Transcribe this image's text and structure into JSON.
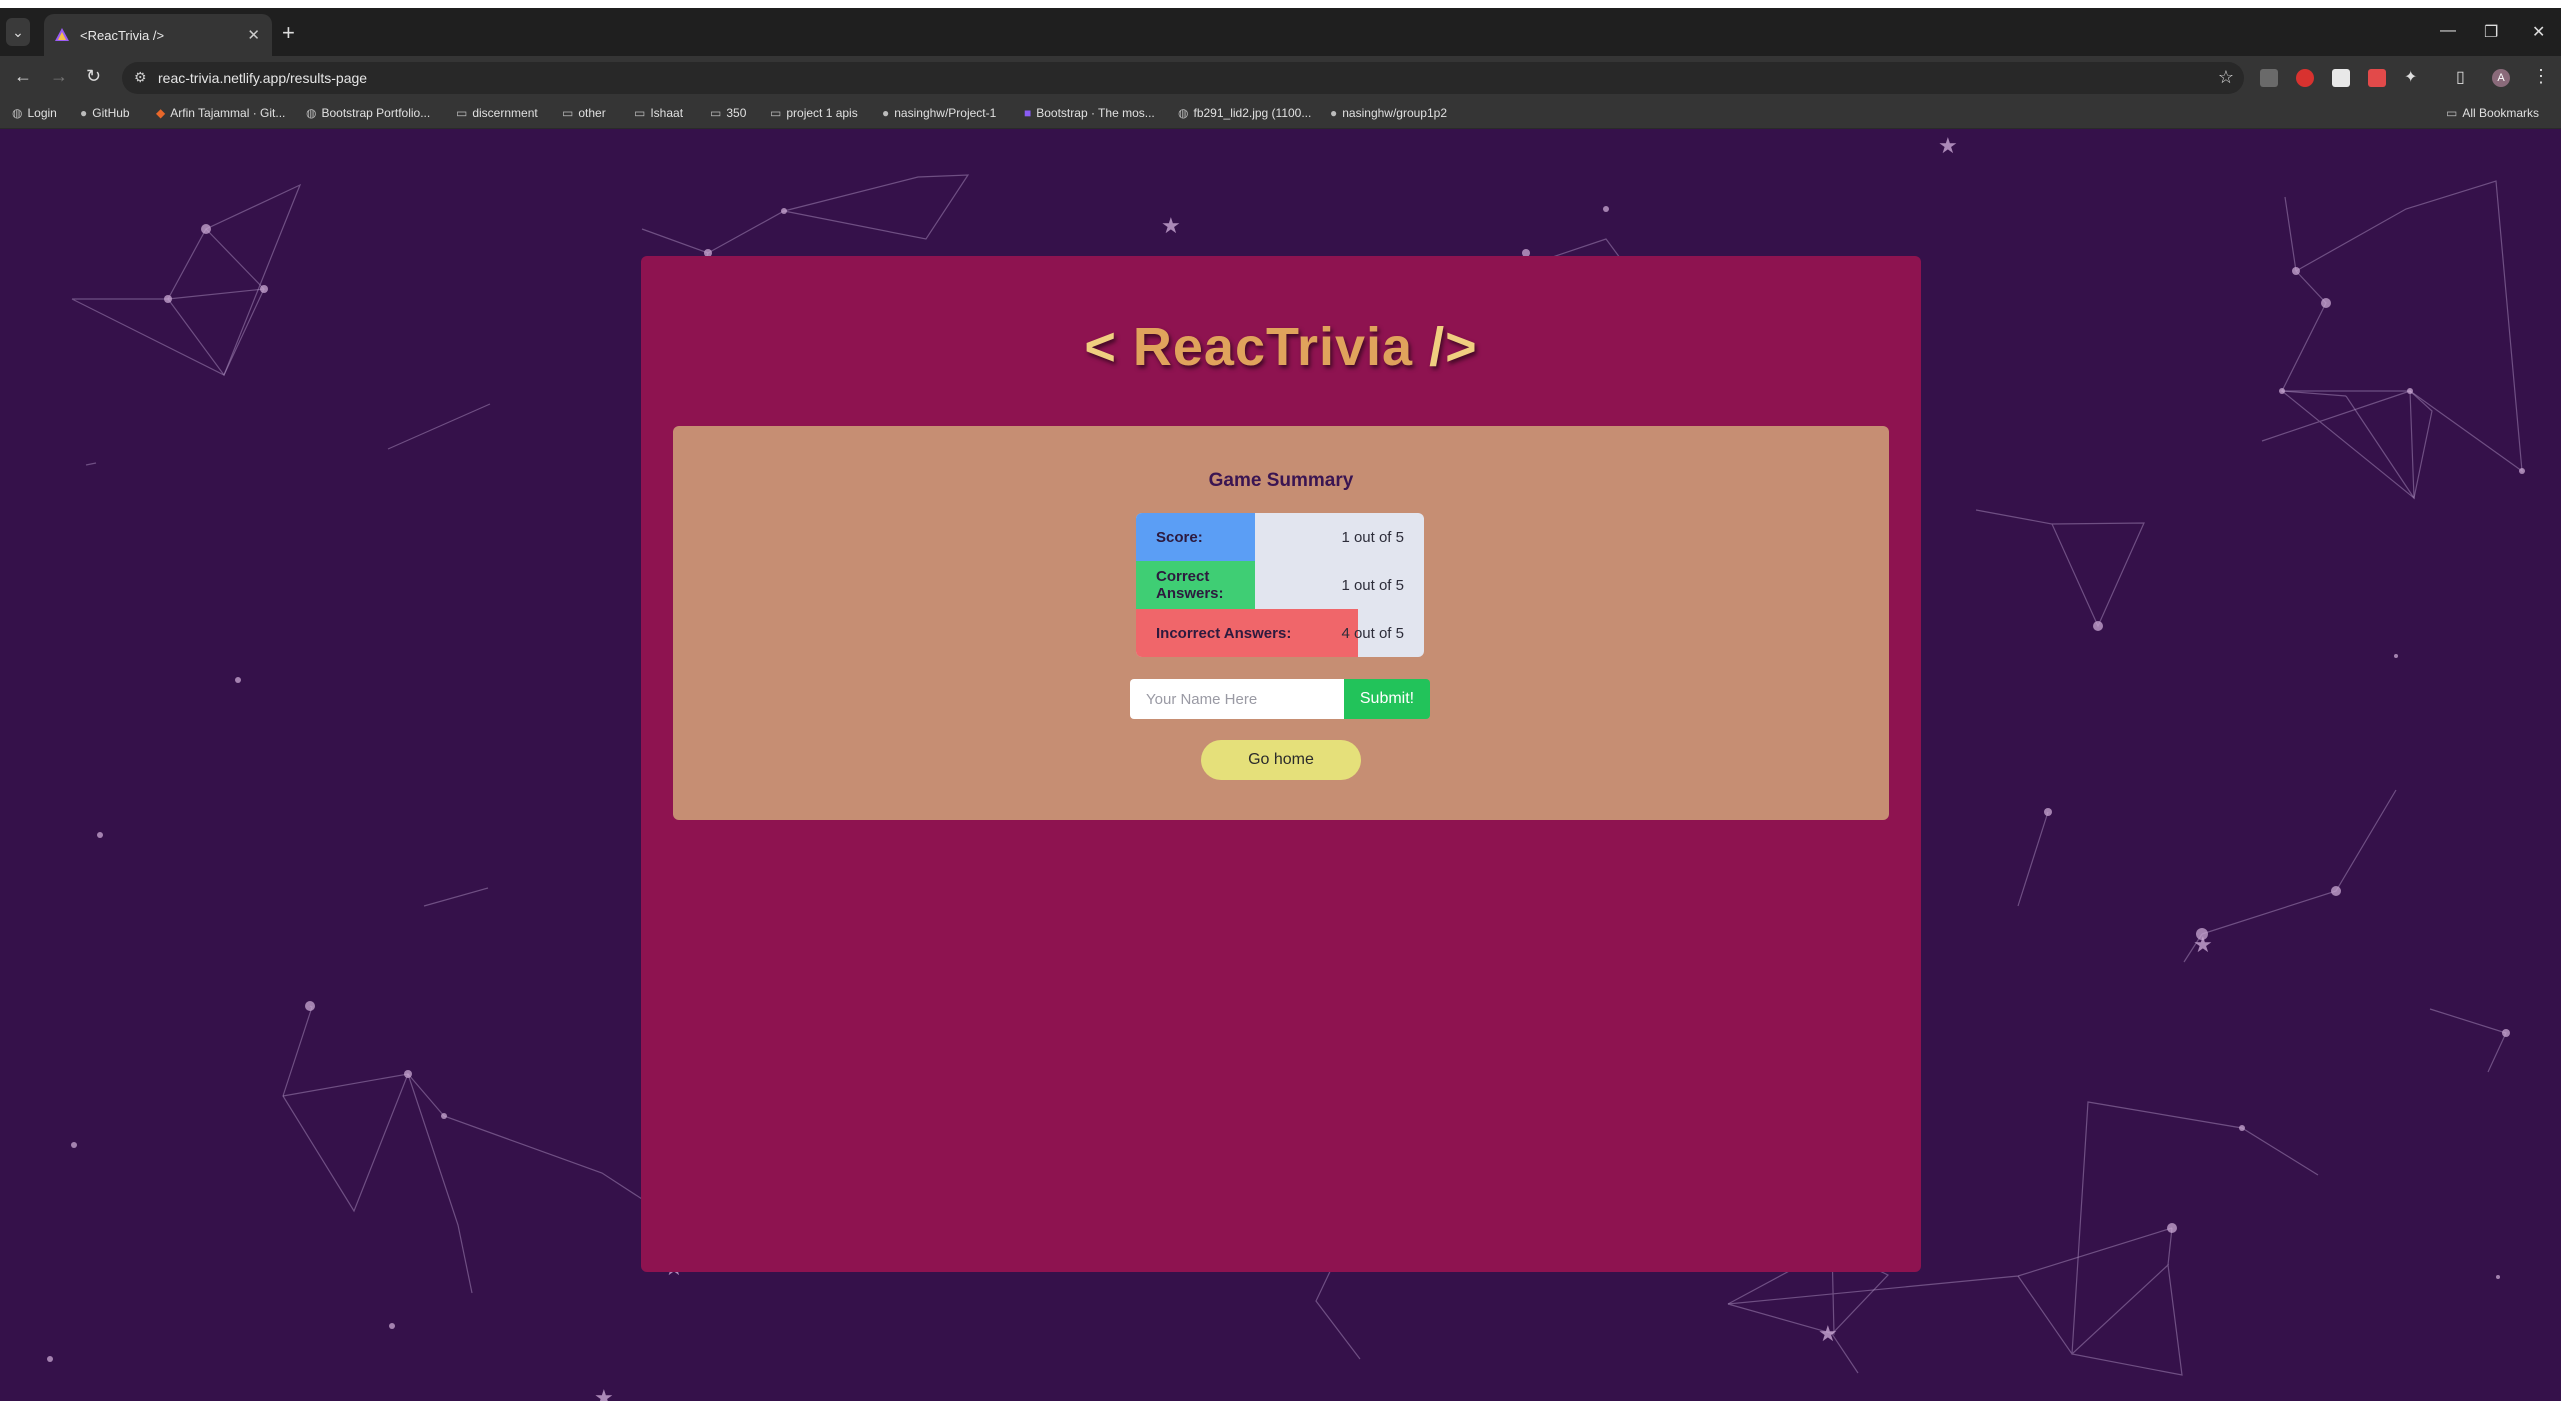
{
  "browser": {
    "tab_title": "<ReacTrivia />",
    "url": "reac-trivia.netlify.app/results-page",
    "bookmarks": [
      {
        "label": "Login",
        "icon": "globe-icon"
      },
      {
        "label": "GitHub",
        "icon": "github-icon"
      },
      {
        "label": "Arfin Tajammal · Git...",
        "icon": "gitlab-icon"
      },
      {
        "label": "Bootstrap Portfolio...",
        "icon": "globe-icon"
      },
      {
        "label": "discernment",
        "icon": "folder-icon"
      },
      {
        "label": "other",
        "icon": "folder-icon"
      },
      {
        "label": "Ishaat",
        "icon": "folder-icon"
      },
      {
        "label": "350",
        "icon": "folder-icon"
      },
      {
        "label": "project 1 apis",
        "icon": "folder-icon"
      },
      {
        "label": "nasinghw/Project-1",
        "icon": "github-icon"
      },
      {
        "label": "Bootstrap · The mos...",
        "icon": "bootstrap-icon"
      },
      {
        "label": "fb291_lid2.jpg (1100...",
        "icon": "globe-icon"
      },
      {
        "label": "nasinghw/group1p2",
        "icon": "github-icon"
      }
    ],
    "all_bookmarks_label": "All Bookmarks"
  },
  "app": {
    "brand_open": "< ",
    "brand_name": "ReacTrivia",
    "brand_close": " />",
    "summary_title": "Game Summary",
    "stats": [
      {
        "label": "Score:",
        "value": "1 out of 5",
        "color": "#5b9ef5",
        "fill_fraction": 0.2
      },
      {
        "label": "Correct Answers:",
        "value": "1 out of 5",
        "color": "#3fce74",
        "fill_fraction": 0.2
      },
      {
        "label": "Incorrect Answers:",
        "value": "4 out of 5",
        "color": "#f0666a",
        "fill_fraction": 0.8
      }
    ],
    "name_placeholder": "Your Name Here",
    "submit_label": "Submit!",
    "home_label": "Go home"
  },
  "colors": {
    "background": "#35114a",
    "card_outer": "#8e1350",
    "card_inner": "#c68e73",
    "brand": "#e0a35c"
  }
}
